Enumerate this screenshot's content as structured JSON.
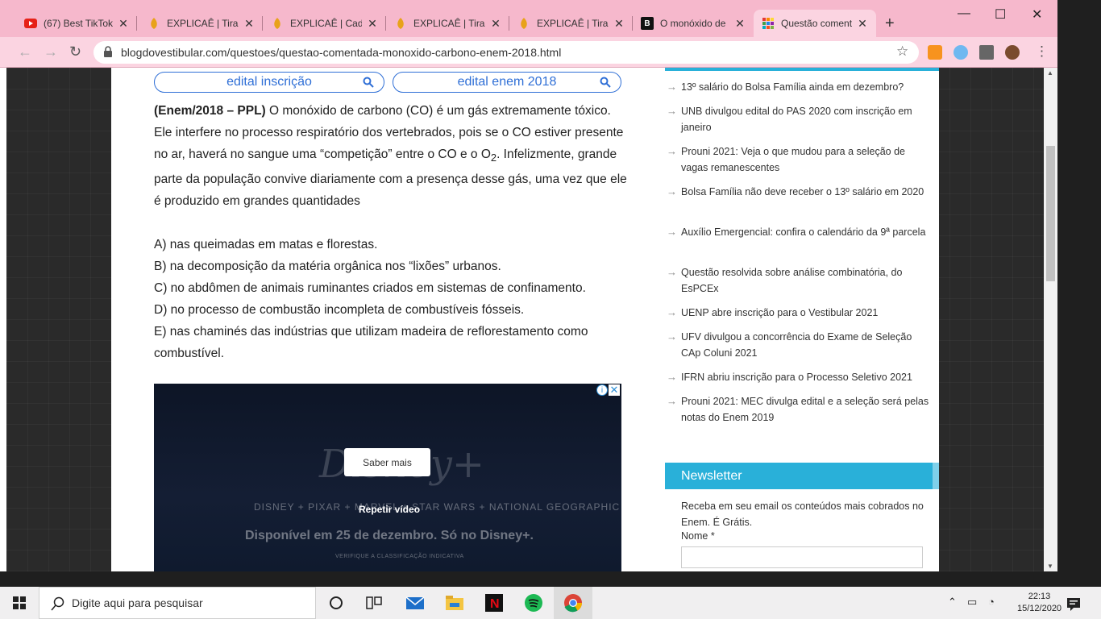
{
  "browser": {
    "tabs": [
      {
        "title": "(67) Best TikTok",
        "icon": "youtube-icon",
        "active": false
      },
      {
        "title": "EXPLICAÊ | Tira-D",
        "icon": "explicae-icon",
        "active": false
      },
      {
        "title": "EXPLICAÊ | Cade",
        "icon": "explicae-icon",
        "active": false
      },
      {
        "title": "EXPLICAÊ | Tira-D",
        "icon": "explicae-icon",
        "active": false
      },
      {
        "title": "EXPLICAÊ | Tira-D",
        "icon": "explicae-icon",
        "active": false
      },
      {
        "title": "O monóxido de",
        "icon": "brainly-icon",
        "active": false
      },
      {
        "title": "Questão coment",
        "icon": "grid-icon",
        "active": true
      }
    ],
    "new_tab": "+",
    "url": "blogdovestibular.com/questoes/questao-comentada-monoxido-carbono-enem-2018.html",
    "accent": "#f6b8cc"
  },
  "page": {
    "search_pills": [
      "edital inscrição",
      "edital enem 2018"
    ],
    "article": {
      "source": "(Enem/2018 – PPL)",
      "intro": " O monóxido de carbono (CO) é um gás extremamente tóxico. Ele interfere no processo respiratório dos vertebrados, pois se o CO estiver presente no ar, haverá no sangue uma “competição” entre o CO e o O",
      "subscript": "2",
      "intro_end": ". Infelizmente, grande parte da população convive diariamente com a presença desse gás, uma vez que ele é produzido em grandes quantidades",
      "options": [
        "A) nas queimadas em matas e florestas.",
        "B) na decomposição da matéria orgânica nos “lixões” urbanos.",
        "C) no abdômen de animais ruminantes criados em sistemas de confinamento.",
        "D) no processo de combustão incompleta de combustíveis fósseis.",
        "E) nas chaminés das indústrias que utilizam madeira de reflorestamento como combustível."
      ]
    },
    "ad": {
      "brand": "Disney+",
      "cta": "Saber mais",
      "replay": "Repetir vídeo",
      "logos": "DISNEY + PIXAR + MARVEL + STAR WARS + NATIONAL GEOGRAPHIC",
      "available": "Disponível em 25 de dezembro. Só no Disney+.",
      "rating": "VERIFIQUE A CLASSIFICAÇÃO INDICATIVA"
    },
    "sidebar": {
      "news": [
        "13º salário do Bolsa Família ainda em dezembro?",
        "UNB divulgou edital do PAS 2020 com inscrição em janeiro",
        "Prouni 2021: Veja o que mudou para a seleção de vagas remanescentes",
        "Bolsa Família não deve receber o 13º salário em 2020",
        "Auxílio Emergencial: confira o calendário da 9ª parcela",
        "Questão resolvida sobre análise combinatória, do EsPCEx",
        "UENP abre inscrição para o Vestibular 2021",
        "UFV divulgou a concorrência do Exame de Seleção CAp Coluni 2021",
        "IFRN abriu inscrição para o Processo Seletivo 2021",
        "Prouni 2021: MEC divulga edital e a seleção será pelas notas do Enem 2019"
      ],
      "newsletter": {
        "title": "Newsletter",
        "text": "Receba em seu email os conteúdos mais cobrados no Enem. É Grátis.",
        "name_label": "Nome *"
      }
    }
  },
  "taskbar": {
    "search_placeholder": "Digite aqui para pesquisar",
    "time": "22:13",
    "date": "15/12/2020"
  }
}
